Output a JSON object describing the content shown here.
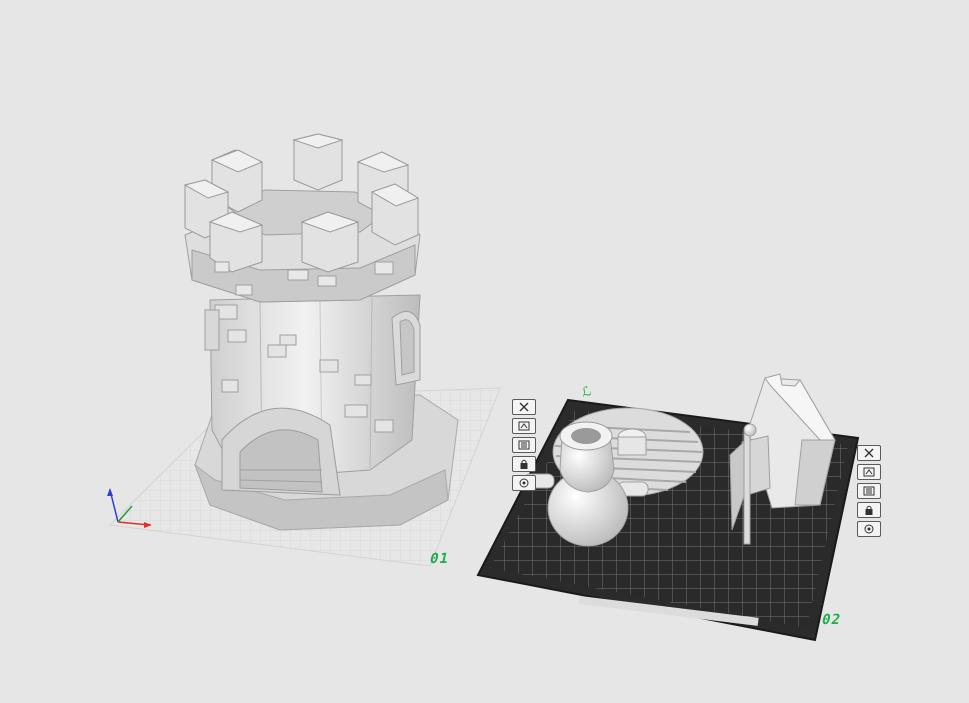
{
  "scene": {
    "background": "#e6e6e6",
    "accent_green": "#1fae4e",
    "axes": {
      "x_color": "#e0302a",
      "y_color": "#2a9a3a",
      "z_color": "#2f3fd0"
    }
  },
  "plates": [
    {
      "label": "01",
      "state": "inactive",
      "objects": [
        "castle-tower"
      ],
      "toolbar": [
        "close-icon",
        "arrange-icon",
        "settings-icon",
        "lock-icon",
        "filament-icon"
      ]
    },
    {
      "label": "02",
      "state": "active",
      "marker": "ℒ",
      "objects": [
        "cannon",
        "round-tile",
        "flag",
        "ramp-wall"
      ],
      "toolbar": [
        "close-icon",
        "arrange-icon",
        "settings-icon",
        "lock-icon",
        "filament-icon"
      ]
    }
  ]
}
